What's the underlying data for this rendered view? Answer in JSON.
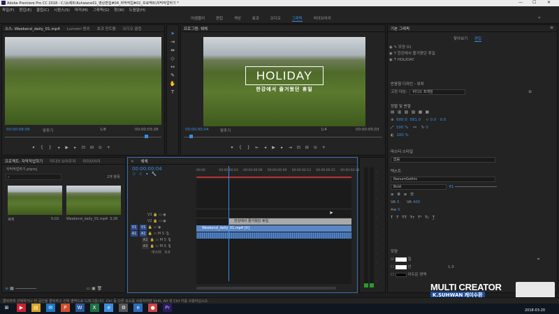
{
  "titlebar": {
    "title": "Adobe Premiere Pro CC 2018 - C:\\뉴제트\\Kuhwane01_영상편집#04_자막작업#02_프로젝트\\자막작업하기 *",
    "controls": [
      "—",
      "☐",
      "✕"
    ]
  },
  "menubar": {
    "items": [
      "파일(F)",
      "편집(E)",
      "클립(C)",
      "시퀀스(S)",
      "마커(M)",
      "그래픽(G)",
      "창(W)",
      "도움말(H)"
    ]
  },
  "workspaces": {
    "items": [
      "어셈블리",
      "편집",
      "색상",
      "효과",
      "오디오",
      "그래픽",
      "라이브러리"
    ],
    "active": "그래픽"
  },
  "source_monitor": {
    "tabs": [
      "소스: Weekend_daily_01.mp4",
      "Lumetri 범위",
      "효과 컨트롤",
      "오디오 클립"
    ],
    "timecode_left": "00:00:08:09",
    "fit": "맞추기",
    "scale": "1/8",
    "timecode_right": "00:00:03:28"
  },
  "program_monitor": {
    "title": "프로그램: 쉐체",
    "overlay_title": "HOLIDAY",
    "overlay_subtitle": "한강에서 즐거웠던 휴일",
    "timecode_left": "00:00:00:04",
    "fit": "맞추기",
    "scale": "1/4",
    "timecode_right": "00:00:05:03"
  },
  "project_panel": {
    "tabs": [
      "프로젝트: 자막작업하기",
      "미디어 브라우저",
      "라이브러리"
    ],
    "project_file": "자막작업하기.prproj",
    "item_count": "2개 항목",
    "items": [
      {
        "name": "쉐체",
        "duration": "5:03"
      },
      {
        "name": "Weekend_daily_01.mp4",
        "duration": "3:28"
      }
    ]
  },
  "timeline": {
    "title": "쉐체",
    "timecode": "00:00:00:04",
    "ruler": [
      "00:00",
      "00:00:00:03",
      "00:00:00:06",
      "00:00:00:09",
      "00:00:00:12",
      "00:00:00:15",
      "00:00:00:18"
    ],
    "video_tracks": [
      "V3",
      "V2",
      "V1"
    ],
    "audio_tracks": [
      "A1",
      "A2",
      "A3"
    ],
    "master": {
      "label": "마스터",
      "value": "0.0"
    },
    "clips": {
      "graphic": "한강에서 즐거웠던 휴일",
      "video": "Weekend_daily_01.mp4 [V]"
    }
  },
  "graphics_panel": {
    "title": "기본 그래픽",
    "tabs": [
      "찾아보기",
      "편집"
    ],
    "active_tab": "편집",
    "layers": [
      "모양 01",
      "한강에서 즐거웠던 휴일",
      "HOLIDAY"
    ],
    "responsive_label": "반응형 디자인 - 위치",
    "pin_label": "고정 대상:",
    "pin_value": "비디오 프레임",
    "align_label": "정렬 및 변형",
    "pos_x": "600.0",
    "pos_y": "581.0",
    "anchor_x": "0.0",
    "anchor_y": "0.0",
    "scale": "100 %",
    "rotation": "0",
    "opacity": "100 %",
    "master_style_label": "마스터 스타일",
    "master_style_value": "없음",
    "text_label": "텍스트",
    "font": "NanumGothic",
    "font_style": "Bold",
    "font_size": "81",
    "kerning": "0",
    "tracking": "400",
    "leading": "0",
    "appearance_label": "모양",
    "fill_label": "칠",
    "stroke_label": "선",
    "shadow_label": "어두운 영역",
    "stroke_value": "1.0"
  },
  "watermark": {
    "line1": "MULTI CREATOR",
    "line2": "K.SUHWAN 케이수환"
  },
  "statusbar": {
    "text": "클릭하여 선택하거나 빈 공간을 클릭하고 선택 영역으로 드래그합니다. Ctrl 등 다른 요소를 사용하려면 Shift, Alt 및 Ctrl 키를 사용하십시오."
  },
  "taskbar": {
    "time": "오후 6:20",
    "date": "2018-03-20"
  }
}
